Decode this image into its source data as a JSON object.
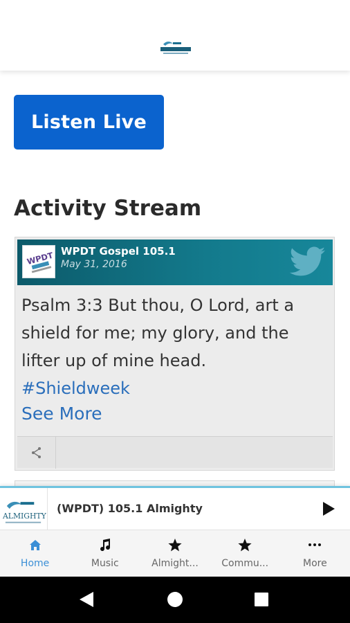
{
  "header": {
    "logo_name": "105.1 Almighty logo"
  },
  "listen_button": {
    "label": "Listen Live"
  },
  "activity": {
    "title": "Activity Stream",
    "posts": [
      {
        "author": "WPDT Gospel 105.1",
        "date": "May 31, 2016",
        "text": "Psalm 3:3 But thou, O Lord, art a shield for me; my glory, and the lifter up of mine head.",
        "hashtag": "#Shieldweek",
        "see_more": "See More",
        "source_icon": "twitter-bird-icon",
        "share_icon": "share-icon"
      }
    ]
  },
  "player": {
    "station": "(WPDT) 105.1 Almighty",
    "logo_text": "ALMIGHTY",
    "play_icon": "play-icon"
  },
  "nav": {
    "items": [
      {
        "label": "Home",
        "icon": "home-icon",
        "active": true
      },
      {
        "label": "Music",
        "icon": "music-note-icon",
        "active": false
      },
      {
        "label": "Almight...",
        "icon": "star-icon",
        "active": false
      },
      {
        "label": "Commu...",
        "icon": "star-icon",
        "active": false
      },
      {
        "label": "More",
        "icon": "more-dots-icon",
        "active": false
      }
    ]
  },
  "colors": {
    "accent_blue": "#0b63ce",
    "card_header_teal": "#137a8c",
    "link_blue": "#2a6ebb",
    "nav_active": "#3b8fd6",
    "player_top_border": "#6fc3df"
  }
}
